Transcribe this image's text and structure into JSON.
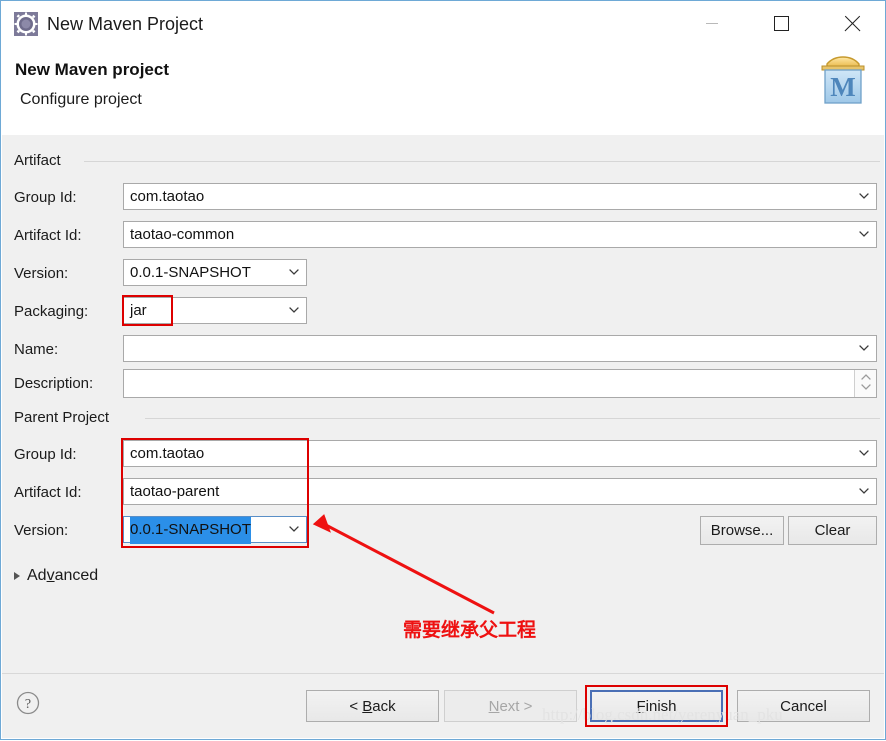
{
  "window": {
    "title": "New Maven Project",
    "icon": "maven-gear-icon",
    "controls": {
      "minimize": "minimize-icon",
      "maximize": "maximize-icon",
      "close": "close-icon"
    }
  },
  "header": {
    "title": "New Maven project",
    "subtitle": "Configure project",
    "logo": "maven-logo-icon"
  },
  "artifact": {
    "group_label": "Artifact",
    "rows": [
      {
        "label": "Group Id:",
        "value": "com.taotao",
        "kind": "combo"
      },
      {
        "label": "Artifact Id:",
        "value": "taotao-common",
        "kind": "combo"
      },
      {
        "label": "Version:",
        "value": "0.0.1-SNAPSHOT",
        "kind": "combo"
      },
      {
        "label": "Packaging:",
        "value": "jar",
        "kind": "combo"
      },
      {
        "label": "Name:",
        "value": "",
        "kind": "combo"
      },
      {
        "label": "Description:",
        "value": "",
        "kind": "textarea"
      }
    ]
  },
  "parent": {
    "group_label": "Parent Project",
    "rows": [
      {
        "label": "Group Id:",
        "value": "com.taotao",
        "kind": "combo"
      },
      {
        "label": "Artifact Id:",
        "value": "taotao-parent",
        "kind": "combo"
      },
      {
        "label": "Version:",
        "value": "0.0.1-SNAPSHOT",
        "kind": "combo-selected"
      }
    ],
    "browse_label": "Browse...",
    "clear_label": "Clear"
  },
  "advanced": {
    "label": "Advanced",
    "mnemonic": "v",
    "expanded": false
  },
  "footer": {
    "help": "help-icon",
    "buttons": [
      {
        "name": "back",
        "pre": "< ",
        "mn": "B",
        "post": "ack",
        "disabled": false,
        "default": false
      },
      {
        "name": "next",
        "pre": "",
        "mn": "N",
        "post": "ext >",
        "disabled": true,
        "default": false
      },
      {
        "name": "finish",
        "pre": "",
        "mn": "F",
        "post": "inish",
        "disabled": false,
        "default": true
      },
      {
        "name": "cancel",
        "pre": "",
        "mn": "",
        "post": "Cancel",
        "disabled": false,
        "default": false
      }
    ]
  },
  "annotations": {
    "note_text": "需要继承父工程",
    "highlight_color": "#dd0000",
    "accent_color": "#2b8fe8"
  },
  "watermark": {
    "text": "http://blog.csdn.net/yerenyuan_pku"
  }
}
